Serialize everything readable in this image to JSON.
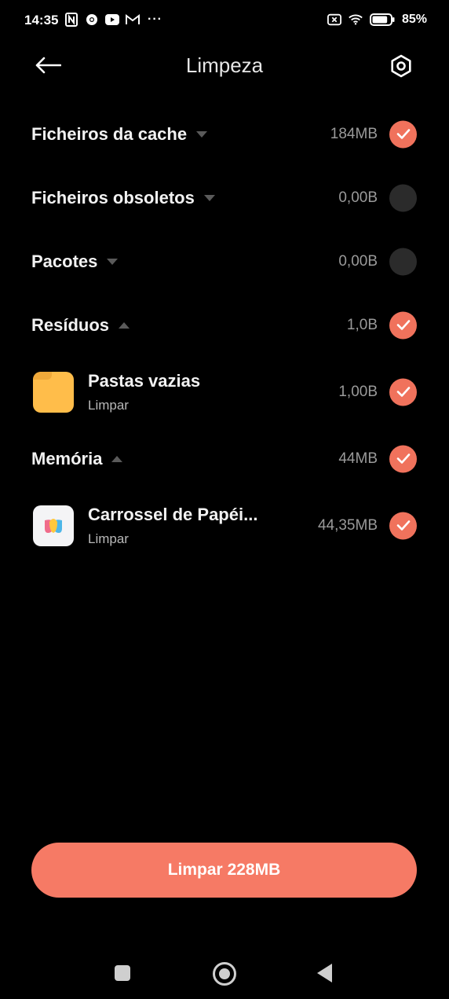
{
  "status_bar": {
    "time": "14:35",
    "left_icons": [
      "nfc-icon",
      "chrome-icon",
      "youtube-icon",
      "gmail-icon"
    ],
    "more": "···",
    "right_icons": [
      "screen-record-icon",
      "wifi-icon",
      "battery-icon"
    ],
    "battery_percent": "85%",
    "battery_level": 0.85
  },
  "header": {
    "title": "Limpeza",
    "back_icon": "arrow-left-icon",
    "settings_icon": "settings-hex-icon"
  },
  "categories": [
    {
      "label": "Ficheiros da cache",
      "size": "184MB",
      "checked": true,
      "expanded": false
    },
    {
      "label": "Ficheiros obsoletos",
      "size": "0,00B",
      "checked": false,
      "expanded": false
    },
    {
      "label": "Pacotes",
      "size": "0,00B",
      "checked": false,
      "expanded": false
    },
    {
      "label": "Resíduos",
      "size": "1,0B",
      "checked": true,
      "expanded": true,
      "items": [
        {
          "title": "Pastas vazias",
          "subtitle": "Limpar",
          "size": "1,00B",
          "checked": true,
          "icon": "folder-icon"
        }
      ]
    },
    {
      "label": "Memória",
      "size": "44MB",
      "checked": true,
      "expanded": true,
      "items": [
        {
          "title": "Carrossel de Papéi...",
          "subtitle": "Limpar",
          "size": "44,35MB",
          "checked": true,
          "icon": "wallpaper-carousel-icon"
        }
      ]
    }
  ],
  "action_button": {
    "label": "Limpar 228MB"
  },
  "colors": {
    "accent": "#f0725c",
    "button": "#f67a65",
    "background": "#000000",
    "unchecked": "#2b2b2b"
  }
}
